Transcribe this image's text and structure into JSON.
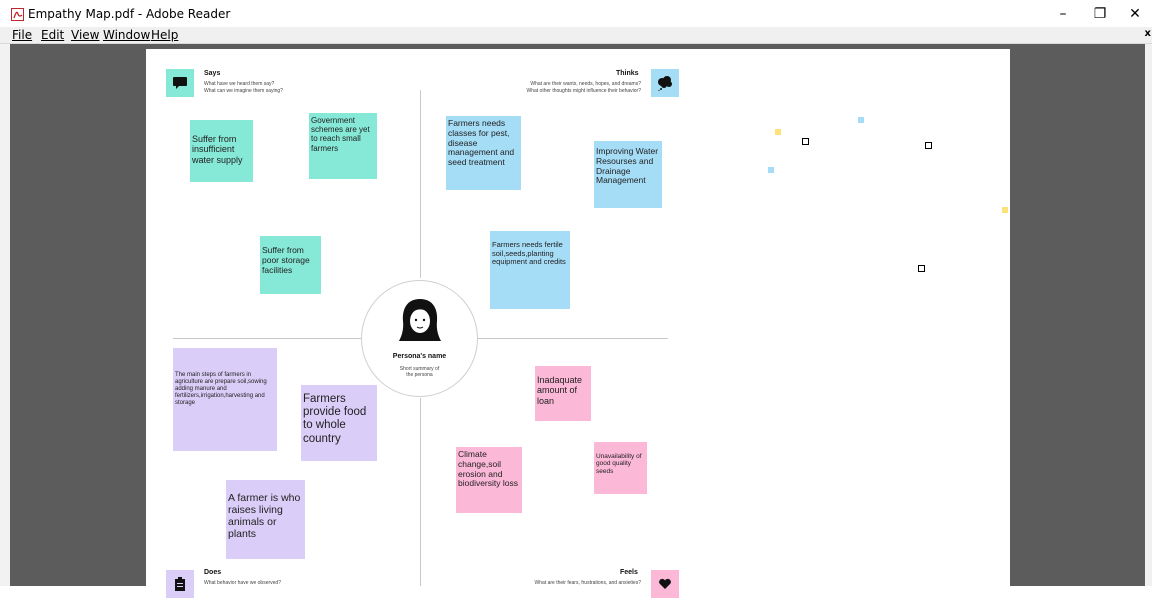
{
  "window": {
    "title": "Empathy Map.pdf - Adobe Reader",
    "minimize": "–",
    "maximize": "❐",
    "close": "✕"
  },
  "menu": {
    "file": "File",
    "edit": "Edit",
    "view": "View",
    "window": "Window",
    "help": "Help",
    "close_doc": "x"
  },
  "map": {
    "says": {
      "title": "Says",
      "subtitle": "What have we heard them say?\nWhat can we imagine them saying?"
    },
    "thinks": {
      "title": "Thinks",
      "subtitle": "What are their wants, needs, hopes, and dreams?\nWhat other thoughts might influence their behavior?"
    },
    "does": {
      "title": "Does",
      "subtitle": "What behavior have we observed?"
    },
    "feels": {
      "title": "Feels",
      "subtitle": "What are their fears, frustrations, and anxieties?"
    },
    "persona": {
      "name": "Persona's name",
      "summary": "Short summary of\nthe persona"
    }
  },
  "notes": {
    "says_1": "Suffer from insufficient water supply",
    "says_2": "Government schemes are yet to reach small farmers",
    "says_3": "Suffer from poor storage facilities",
    "thinks_1": "Farmers needs classes for pest, disease management and seed treatment",
    "thinks_2": "Improving Water Resourses and Drainage Management",
    "thinks_3": "Farmers needs fertile soil,seeds,planting equipment and credits",
    "does_1": "The main steps of farmers in agriculture are prepare soil,sowing adding manure and fertilizers,irrigation,harvesting and storage",
    "does_2": "Farmers provide food to whole country",
    "does_3": "A farmer is who raises living animals or plants",
    "feels_1": "Inadaquate amount of loan",
    "feels_2": "Climate change,soil erosion and biodiversity loss",
    "feels_3": "Unavailability of good quality seeds"
  },
  "colors": {
    "teal": "#86e8d6",
    "blue": "#a5ddf7",
    "purple": "#dacdf8",
    "pink": "#fcb8d7",
    "workspace": "#5c5c5c"
  }
}
